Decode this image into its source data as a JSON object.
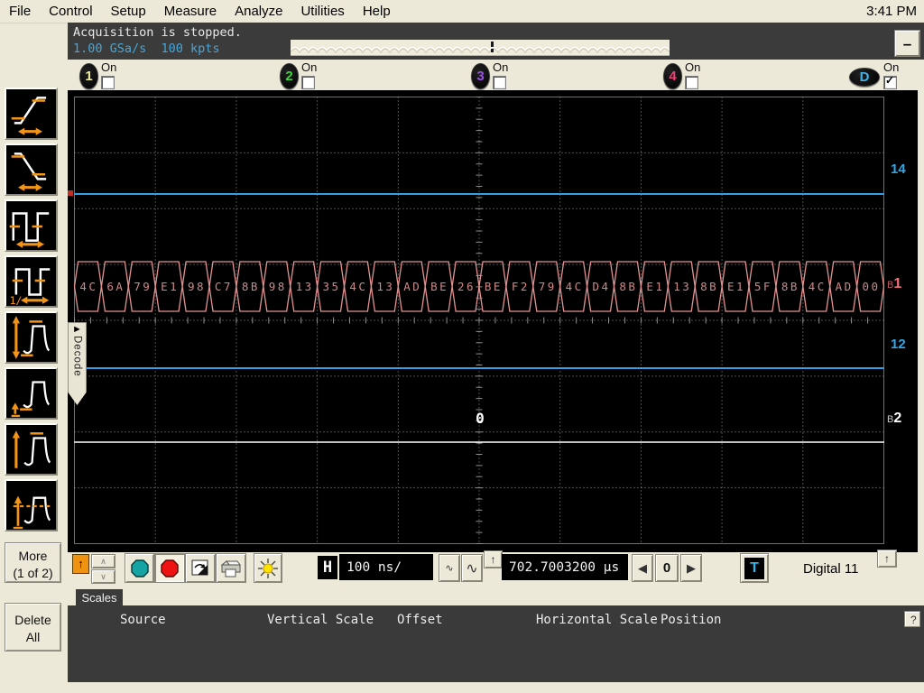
{
  "menu": {
    "items": [
      "File",
      "Control",
      "Setup",
      "Measure",
      "Analyze",
      "Utilities",
      "Help"
    ],
    "clock": "3:41 PM"
  },
  "window": {
    "minimize_glyph": "–"
  },
  "status": {
    "line1": "Acquisition is stopped.",
    "line2": "1.00 GSa/s  100 kpts"
  },
  "channels": [
    {
      "id": "1",
      "on_label": "On",
      "checked": false,
      "digit_color": "#f2ef9d",
      "shape": "tall"
    },
    {
      "id": "2",
      "on_label": "On",
      "checked": false,
      "digit_color": "#3ed43e",
      "shape": "tall"
    },
    {
      "id": "3",
      "on_label": "On",
      "checked": false,
      "digit_color": "#9a55e0",
      "shape": "tall"
    },
    {
      "id": "4",
      "on_label": "On",
      "checked": false,
      "digit_color": "#ee3f77",
      "shape": "tall"
    },
    {
      "id": "D",
      "on_label": "On",
      "checked": true,
      "check_glyph": "✓",
      "digit_color": "#3fb2ea",
      "shape": "wide"
    }
  ],
  "sidebar": {
    "icons": [
      "rise-time-icon",
      "fall-time-icon",
      "period-icon",
      "frequency-icon",
      "peak-peak-icon",
      "minimum-icon",
      "maximum-icon",
      "average-icon"
    ],
    "more_line1": "More",
    "more_line2": "(1 of 2)",
    "delete_line1": "Delete",
    "delete_line2": "All"
  },
  "decode_tab": {
    "label": "Decode",
    "arrow_glyph": "►"
  },
  "chart_data": {
    "type": "digital-timing",
    "acquisition": {
      "state": "Acquisition is stopped.",
      "sample_rate": "1.00 GSa/s",
      "memory_depth": "100 kpts"
    },
    "horizontal": {
      "scale": "100 ns/",
      "position": "702.7003200 µs",
      "reference_marker": "0"
    },
    "grid": {
      "columns": 10,
      "rows": 8
    },
    "signals": [
      {
        "name": "14",
        "kind": "digital",
        "state": "high",
        "color": "#2f9fe8",
        "label_color": "#2fa9ea"
      },
      {
        "name": "B1",
        "kind": "bus",
        "encoding": "hex",
        "color": "#e29292",
        "label_color": "#ee727b",
        "values": [
          "4C",
          "6A",
          "79",
          "E1",
          "98",
          "C7",
          "8B",
          "98",
          "13",
          "35",
          "4C",
          "13",
          "AD",
          "BE",
          "26",
          "BE",
          "F2",
          "79",
          "4C",
          "D4",
          "8B",
          "E1",
          "13",
          "8B",
          "E1",
          "5F",
          "8B",
          "4C",
          "AD",
          "00"
        ]
      },
      {
        "name": "12",
        "kind": "digital",
        "state": "high",
        "color": "#2f9fe8",
        "label_color": "#2fa9ea"
      },
      {
        "name": "B2",
        "kind": "bus",
        "encoding": "idle",
        "color": "#ffffff",
        "label_color": "#ffffff",
        "values": []
      }
    ]
  },
  "toolbar": {
    "timebase_label": "H",
    "timebase_value": "100 ns/",
    "position_value": "702.7003200 µs",
    "zero_label": "0",
    "trigger_label": "T",
    "trigger_source": "Digital 11",
    "glyphs": {
      "up_arrow": "↑",
      "spin_up": "∧",
      "spin_down": "∨",
      "left": "◀",
      "right": "▶",
      "squiggle_small": "∿",
      "squiggle_large": "∿"
    }
  },
  "panel": {
    "tab": "Scales",
    "headers": [
      "Source",
      "Vertical Scale",
      "Offset",
      "Horizontal Scale",
      "Position"
    ],
    "help": "?"
  }
}
